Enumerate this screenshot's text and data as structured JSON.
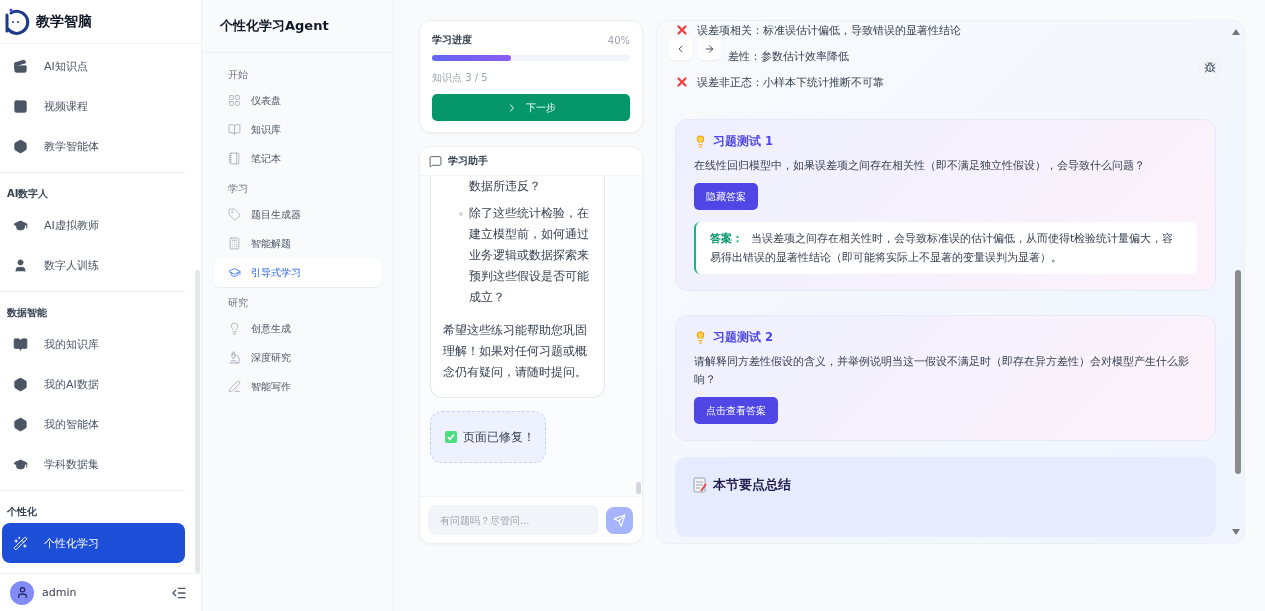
{
  "sidebar": {
    "brand": "教学智脑",
    "sections": [
      {
        "items": [
          {
            "label": "AI知识点",
            "selected": false
          },
          {
            "label": "视频课程",
            "selected": false
          },
          {
            "label": "教学智能体",
            "selected": false
          }
        ]
      },
      {
        "label": "AI数字人",
        "items": [
          {
            "label": "AI虚拟教师",
            "selected": false
          },
          {
            "label": "数字人训练",
            "selected": false
          }
        ]
      },
      {
        "label": "数据智能",
        "items": [
          {
            "label": "我的知识库",
            "selected": false
          },
          {
            "label": "我的AI数据",
            "selected": false
          },
          {
            "label": "我的智能体",
            "selected": false
          },
          {
            "label": "学科数据集",
            "selected": false
          }
        ]
      },
      {
        "label": "个性化",
        "items": [
          {
            "label": "个性化学习",
            "selected": true
          }
        ]
      }
    ],
    "user": "admin"
  },
  "nav": {
    "title": "个性化学习Agent",
    "sections": [
      {
        "label": "开始",
        "items": [
          {
            "label": "仪表盘",
            "selected": false
          },
          {
            "label": "知识库",
            "selected": false
          },
          {
            "label": "笔记本",
            "selected": false
          }
        ]
      },
      {
        "label": "学习",
        "items": [
          {
            "label": "题目生成器",
            "selected": false
          },
          {
            "label": "智能解题",
            "selected": false
          },
          {
            "label": "引导式学习",
            "selected": true
          }
        ]
      },
      {
        "label": "研究",
        "items": [
          {
            "label": "创意生成",
            "selected": false
          },
          {
            "label": "深度研究",
            "selected": false
          },
          {
            "label": "智能写作",
            "selected": false
          }
        ]
      }
    ]
  },
  "progress": {
    "title": "学习进度",
    "percent": "40%",
    "level": 0.4,
    "caption": "知识点 3 / 5",
    "button": "下一步"
  },
  "chat": {
    "title": "学习助手",
    "items": [
      {
        "kind": "continuation",
        "text": "数据所违反？"
      },
      {
        "kind": "bullet",
        "text": "除了这些统计检验，在建立模型前，如何通过业务逻辑或数据探索来预判这些假设是否可能成立？"
      }
    ],
    "closing": "希望这些练习能帮助您巩固理解！如果对任何习题或概念仍有疑问，请随时提问。",
    "status": "页面已修复！",
    "placeholder": "有问题吗？尽管问..."
  },
  "content": {
    "issues": [
      {
        "kind": "error",
        "text": "误差项相关：标准误估计偏低，导致错误的显著性结论"
      },
      {
        "kind": "partial",
        "text": "差性：参数估计效率降低"
      },
      {
        "kind": "error",
        "text": "误差非正态：小样本下统计推断不可靠"
      }
    ],
    "quizzes": [
      {
        "title": "习题测试 1",
        "question": "在线性回归模型中，如果误差项之间存在相关性（即不满足独立性假设），会导致什么问题？",
        "button": "隐藏答案",
        "expanded": true,
        "answer_label": "答案：",
        "answer": "当误差项之间存在相关性时，会导致标准误的估计偏低，从而使得t检验统计量偏大，容易得出错误的显著性结论（即可能将实际上不显著的变量误判为显著）。"
      },
      {
        "title": "习题测试 2",
        "question": "请解释同方差性假设的含义，并举例说明当这一假设不满足时（即存在异方差性）会对模型产生什么影响？",
        "button": "点击查看答案",
        "expanded": false
      }
    ],
    "summary": "本节要点总结"
  }
}
